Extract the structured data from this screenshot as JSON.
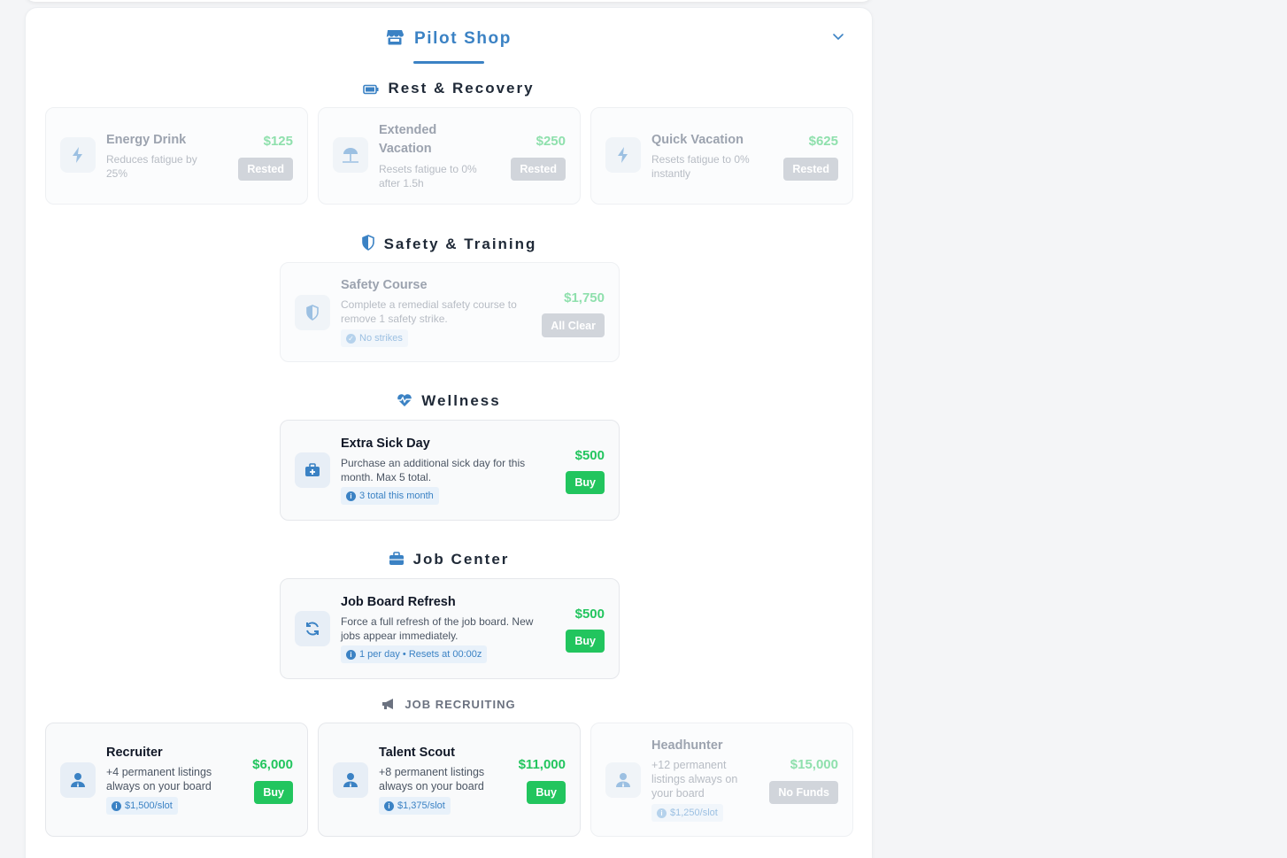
{
  "shop": {
    "title": "Pilot Shop",
    "title_icon": "store-icon",
    "collapse_icon": "chevron-down-icon",
    "accent_color": "#3b82c4",
    "buy_color": "#22c55e"
  },
  "sections": {
    "rest": {
      "title": "Rest & Recovery",
      "icon": "battery-icon",
      "items": [
        {
          "name": "Energy Drink",
          "desc": "Reduces fatigue by 25%",
          "price": "$125",
          "button": "Rested",
          "icon": "bolt-icon"
        },
        {
          "name": "Extended Vacation",
          "desc": "Resets fatigue to 0% after 1.5h",
          "price": "$250",
          "button": "Rested",
          "icon": "umbrella-beach-icon"
        },
        {
          "name": "Quick Vacation",
          "desc": "Resets fatigue to 0% instantly",
          "price": "$625",
          "button": "Rested",
          "icon": "bolt-icon"
        }
      ]
    },
    "safety": {
      "title": "Safety & Training",
      "icon": "shield-icon",
      "item": {
        "name": "Safety Course",
        "desc": "Complete a remedial safety course to remove 1 safety strike.",
        "price": "$1,750",
        "button": "All Clear",
        "badge": "No strikes",
        "icon": "shield-icon"
      }
    },
    "wellness": {
      "title": "Wellness",
      "icon": "heart-pulse-icon",
      "item": {
        "name": "Extra Sick Day",
        "desc": "Purchase an additional sick day for this month. Max 5 total.",
        "price": "$500",
        "button": "Buy",
        "badge": "3 total this month",
        "icon": "medical-kit-icon"
      }
    },
    "jobcenter": {
      "title": "Job Center",
      "icon": "briefcase-icon",
      "item": {
        "name": "Job Board Refresh",
        "desc": "Force a full refresh of the job board. New jobs appear immediately.",
        "price": "$500",
        "button": "Buy",
        "badge": "1 per day • Resets at 00:00z",
        "icon": "refresh-icon"
      }
    },
    "recruiting": {
      "title": "JOB RECRUITING",
      "icon": "megaphone-icon",
      "items": [
        {
          "name": "Recruiter",
          "desc": "+4 permanent listings always on your board",
          "price": "$6,000",
          "button": "Buy",
          "badge": "$1,500/slot",
          "icon": "user-tie-icon"
        },
        {
          "name": "Talent Scout",
          "desc": "+8 permanent listings always on your board",
          "price": "$11,000",
          "button": "Buy",
          "badge": "$1,375/slot",
          "icon": "user-tie-icon"
        },
        {
          "name": "Headhunter",
          "desc": "+12 permanent listings always on your board",
          "price": "$15,000",
          "button": "No Funds",
          "badge": "$1,250/slot",
          "icon": "user-tie-icon"
        }
      ]
    }
  }
}
